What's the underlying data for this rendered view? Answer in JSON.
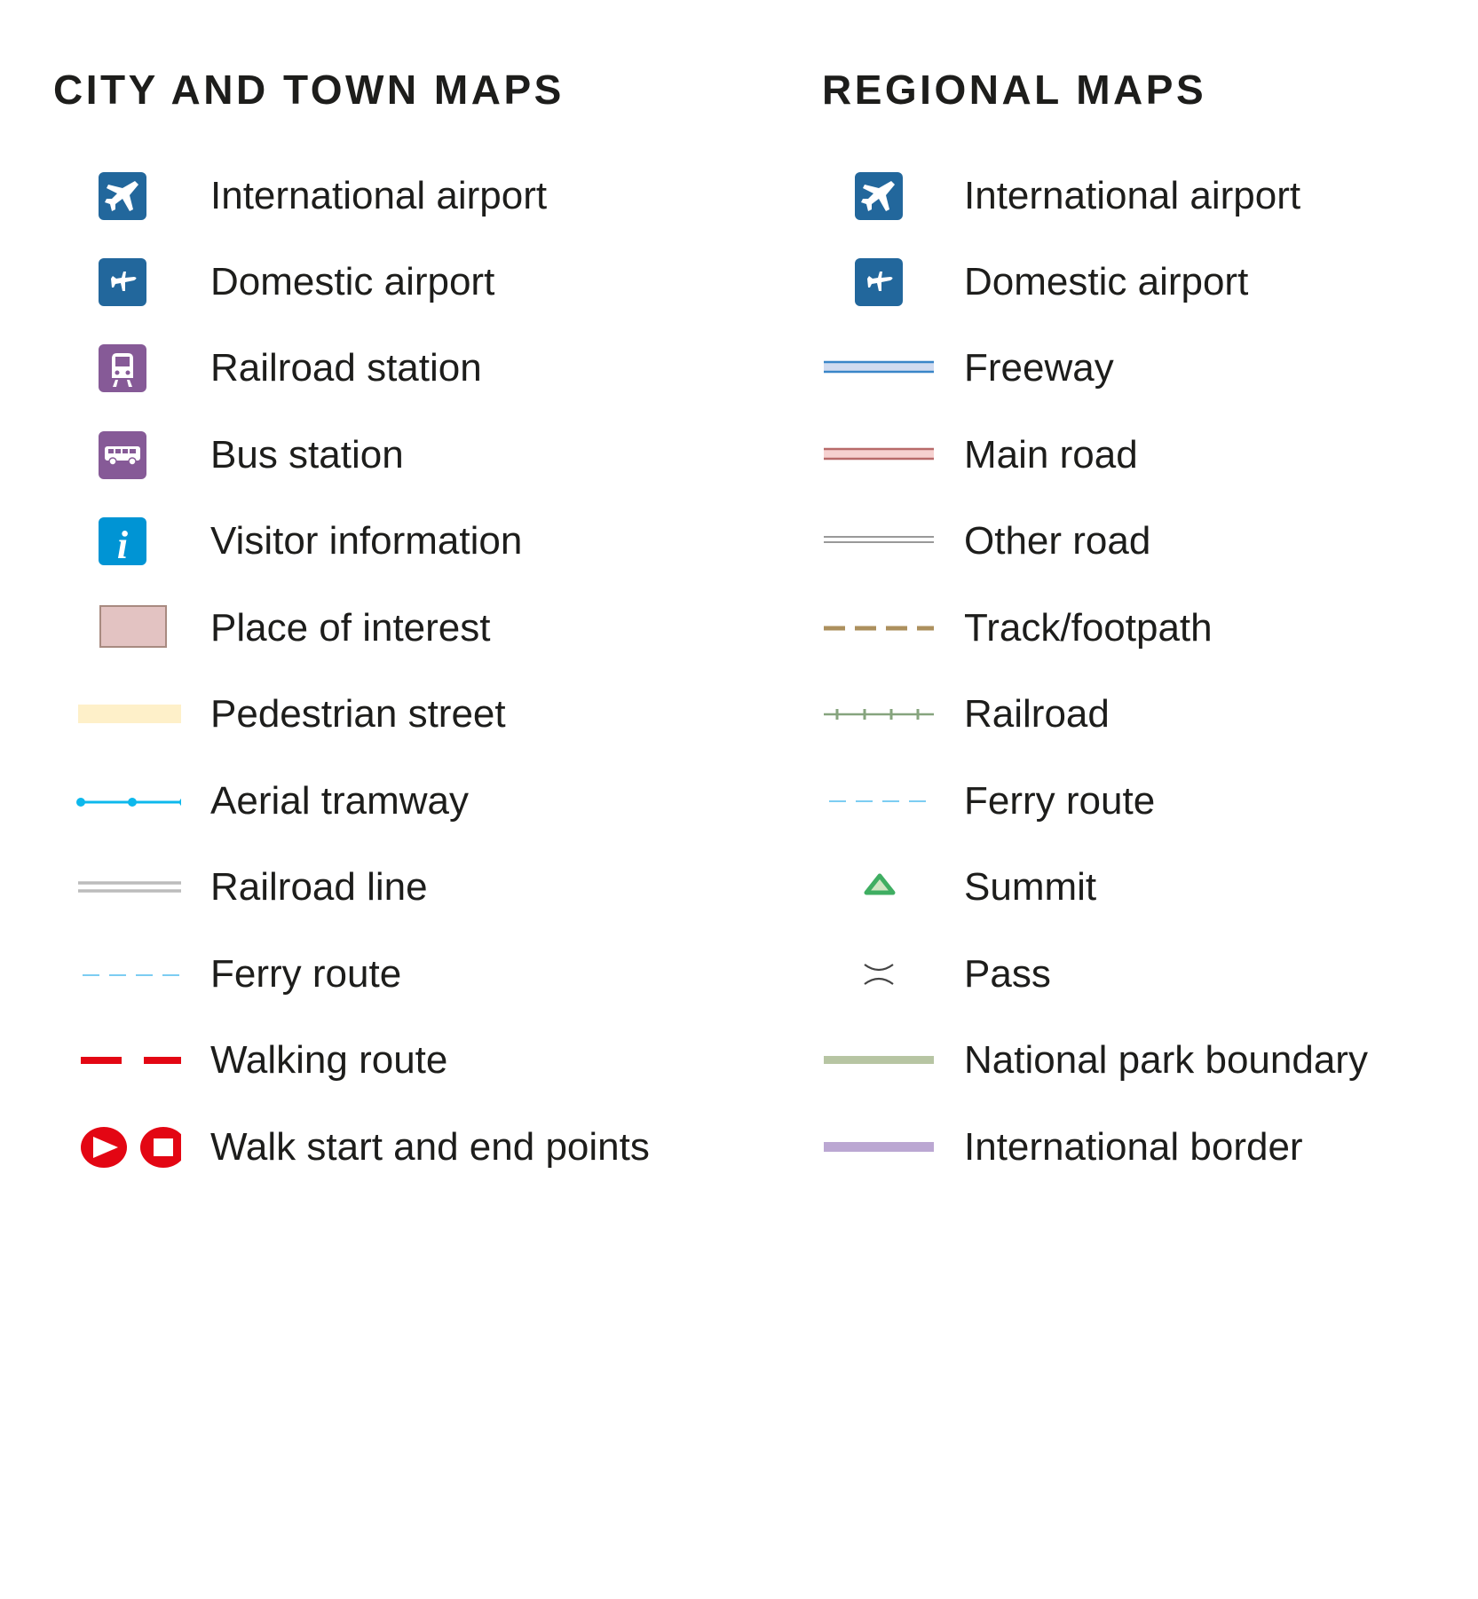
{
  "city": {
    "heading": "CITY AND TOWN MAPS",
    "items": [
      {
        "label": "International airport",
        "icon": "international-airport-icon"
      },
      {
        "label": "Domestic airport",
        "icon": "domestic-airport-icon"
      },
      {
        "label": "Railroad station",
        "icon": "railroad-station-icon"
      },
      {
        "label": "Bus station",
        "icon": "bus-station-icon"
      },
      {
        "label": "Visitor information",
        "icon": "visitor-information-icon"
      },
      {
        "label": "Place of interest",
        "icon": "place-of-interest-swatch"
      },
      {
        "label": "Pedestrian street",
        "icon": "pedestrian-street-swatch"
      },
      {
        "label": "Aerial tramway",
        "icon": "aerial-tramway-line"
      },
      {
        "label": "Railroad line",
        "icon": "railroad-line"
      },
      {
        "label": "Ferry route",
        "icon": "ferry-route-line"
      },
      {
        "label": "Walking route",
        "icon": "walking-route-line"
      },
      {
        "label": "Walk start and end points",
        "icon": "walk-start-end-icon"
      }
    ]
  },
  "regional": {
    "heading": "REGIONAL MAPS",
    "items": [
      {
        "label": "International airport",
        "icon": "international-airport-icon"
      },
      {
        "label": "Domestic airport",
        "icon": "domestic-airport-icon"
      },
      {
        "label": "Freeway",
        "icon": "freeway-line"
      },
      {
        "label": "Main road",
        "icon": "main-road-line"
      },
      {
        "label": "Other road",
        "icon": "other-road-line"
      },
      {
        "label": "Track/footpath",
        "icon": "track-footpath-line"
      },
      {
        "label": "Railroad",
        "icon": "railroad-track-line"
      },
      {
        "label": "Ferry route",
        "icon": "ferry-route-line"
      },
      {
        "label": "Summit",
        "icon": "summit-icon"
      },
      {
        "label": "Pass",
        "icon": "pass-icon"
      },
      {
        "label": "National park boundary",
        "icon": "national-park-boundary-line"
      },
      {
        "label": "International border",
        "icon": "international-border-line"
      }
    ]
  },
  "colors": {
    "airport_blue": "#22679c",
    "transit_purple": "#865a97",
    "info_blue": "#0094d4",
    "walk_red": "#e30613",
    "tramway_cyan": "#0db8ec",
    "ferry_blue": "#7ccdf2"
  }
}
